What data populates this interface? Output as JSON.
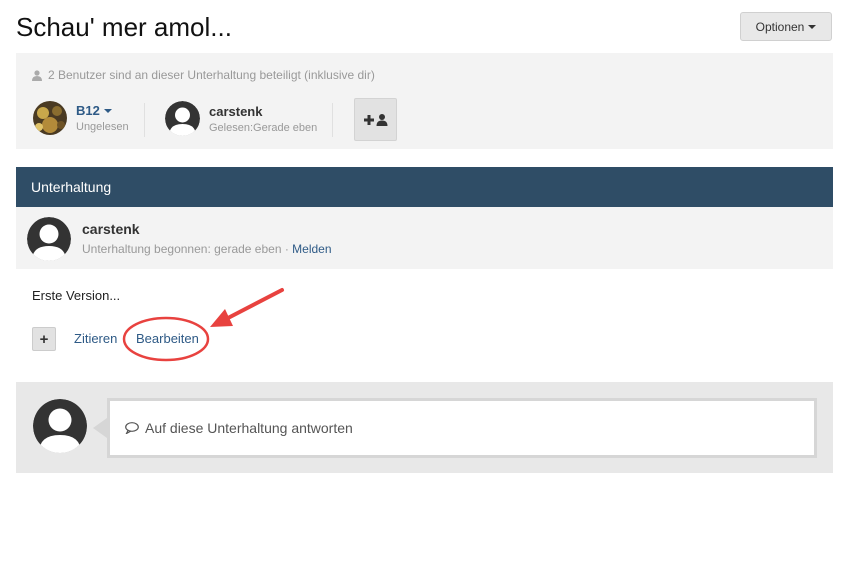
{
  "page": {
    "title": "Schau' mer amol..."
  },
  "options_button": {
    "label": "Optionen"
  },
  "participants": {
    "note": "2 Benutzer sind an dieser Unterhaltung beteiligt (inklusive dir)",
    "users": [
      {
        "name": "B12",
        "status": "Ungelesen"
      },
      {
        "name": "carstenk",
        "status": "Gelesen:Gerade eben"
      }
    ]
  },
  "conversation": {
    "header": "Unterhaltung",
    "message": {
      "author": "carstenk",
      "meta_prefix": "Unterhaltung begonnen: gerade eben · ",
      "report_link": "Melden",
      "body": "Erste Version...",
      "plus_label": "+",
      "quote_link": "Zitieren",
      "edit_link": "Bearbeiten"
    }
  },
  "reply": {
    "placeholder": "Auf diese Unterhaltung antworten"
  },
  "colors": {
    "header_bg": "#2f4d66",
    "link": "#2e5a86",
    "annotation": "#e8423f"
  }
}
